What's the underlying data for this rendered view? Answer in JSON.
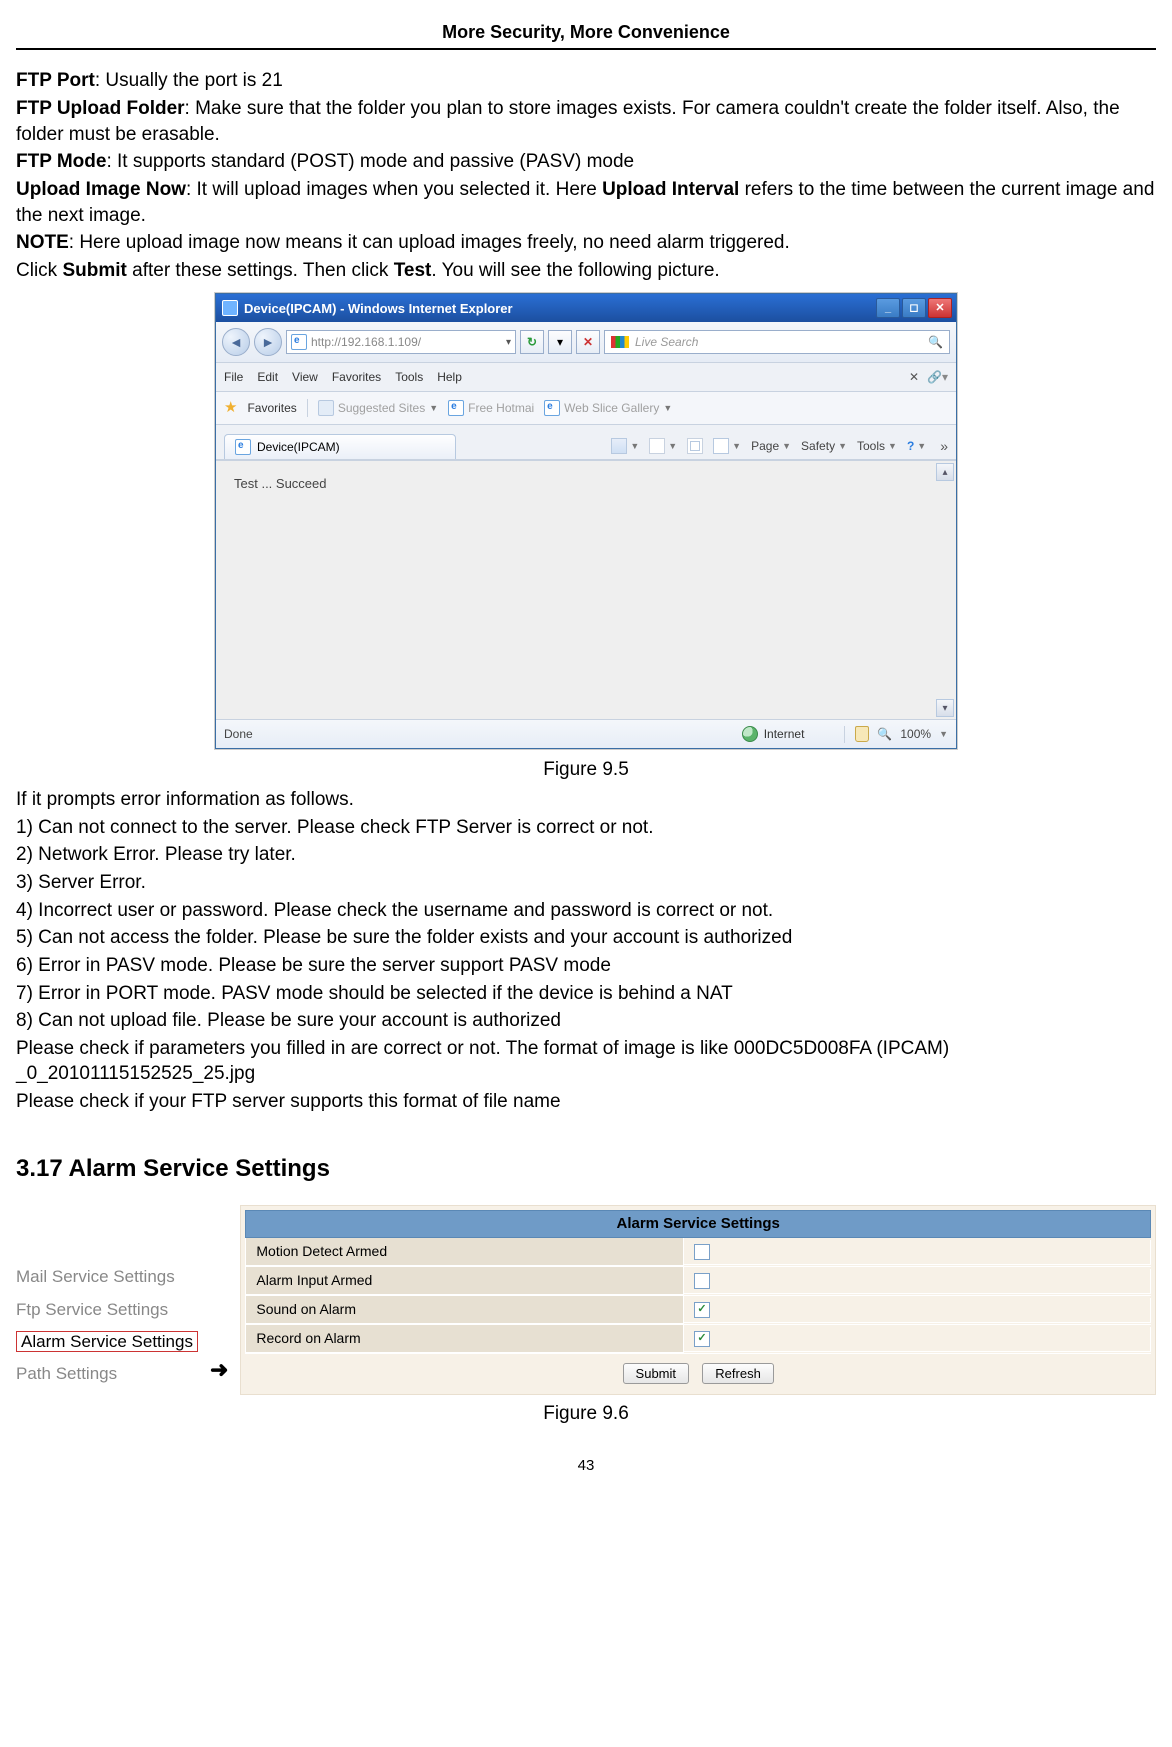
{
  "header": "More Security, More Convenience",
  "intro": {
    "ftpPort_label": "FTP Port",
    "ftpPort_text": ": Usually the port is 21",
    "ftpFolder_label": "FTP Upload Folder",
    "ftpFolder_text": ": Make sure that the folder you plan to store images exists. For camera couldn't create the folder itself. Also, the folder must be erasable.",
    "ftpMode_label": "FTP Mode",
    "ftpMode_text": ": It supports standard (POST) mode and passive (PASV) mode",
    "uploadNow_label": "Upload Image Now",
    "uploadNow_text_a": ": It will upload images when you selected it. Here ",
    "uploadNow_bold": "Upload Interval",
    "uploadNow_text_b": " refers to the time between the current image and the next image.",
    "note_label": "NOTE",
    "note_text": ": Here upload image now means it can upload images freely, no need alarm triggered.",
    "click_a": "Click ",
    "click_submit": "Submit",
    "click_b": " after these settings. Then click ",
    "click_test": "Test",
    "click_c": ". You will see the following picture."
  },
  "browser": {
    "title": "Device(IPCAM) - Windows Internet Explorer",
    "address": "http://192.168.1.109/",
    "liveSearch": "Live Search",
    "menus": [
      "File",
      "Edit",
      "View",
      "Favorites",
      "Tools",
      "Help"
    ],
    "favLabel": "Favorites",
    "suggested": "Suggested Sites",
    "freeHotmail": "Free Hotmai",
    "webSlice": "Web Slice Gallery",
    "tabLabel": "Device(IPCAM)",
    "tools": {
      "page": "Page",
      "safety": "Safety",
      "toolsLbl": "Tools"
    },
    "content": "Test  ...  Succeed",
    "statusDone": "Done",
    "statusZone": "Internet",
    "zoom": "100%"
  },
  "fig95": "Figure 9.5",
  "errorIntro": "If it prompts error information as follows.",
  "errors": [
    "1) Can not connect to the server. Please check FTP Server is correct or not.",
    "2) Network Error. Please try later.",
    "3) Server Error.",
    "4) Incorrect user or password. Please check the username and password is correct or not.",
    "5) Can not access the folder. Please be sure the folder exists and your account is authorized",
    "6) Error in PASV mode. Please be sure the server support PASV mode",
    "7) Error in PORT mode. PASV mode should be selected if the device is behind a NAT",
    "8) Can not upload file. Please be sure your account is authorized"
  ],
  "checkParams": "Please check if parameters you filled in are correct or not. The format of image is like 000DC5D008FA (IPCAM) _0_20101115152525_25.jpg",
  "checkFtp": "Please check if your FTP server supports this format of file name",
  "sectionTitle": "3.17 Alarm Service Settings",
  "sideLinks": {
    "mail": "Mail Service Settings",
    "ftp": "Ftp Service Settings",
    "alarm": "Alarm Service Settings",
    "path": "Path Settings"
  },
  "arrow": "➜",
  "alarm": {
    "head": "Alarm Service Settings",
    "rows": [
      {
        "label": "Motion Detect Armed",
        "checked": false
      },
      {
        "label": "Alarm Input Armed",
        "checked": false
      },
      {
        "label": "Sound on Alarm",
        "checked": true
      },
      {
        "label": "Record on Alarm",
        "checked": true
      }
    ],
    "submit": "Submit",
    "refresh": "Refresh"
  },
  "fig96": "Figure 9.6",
  "pageNumber": "43"
}
